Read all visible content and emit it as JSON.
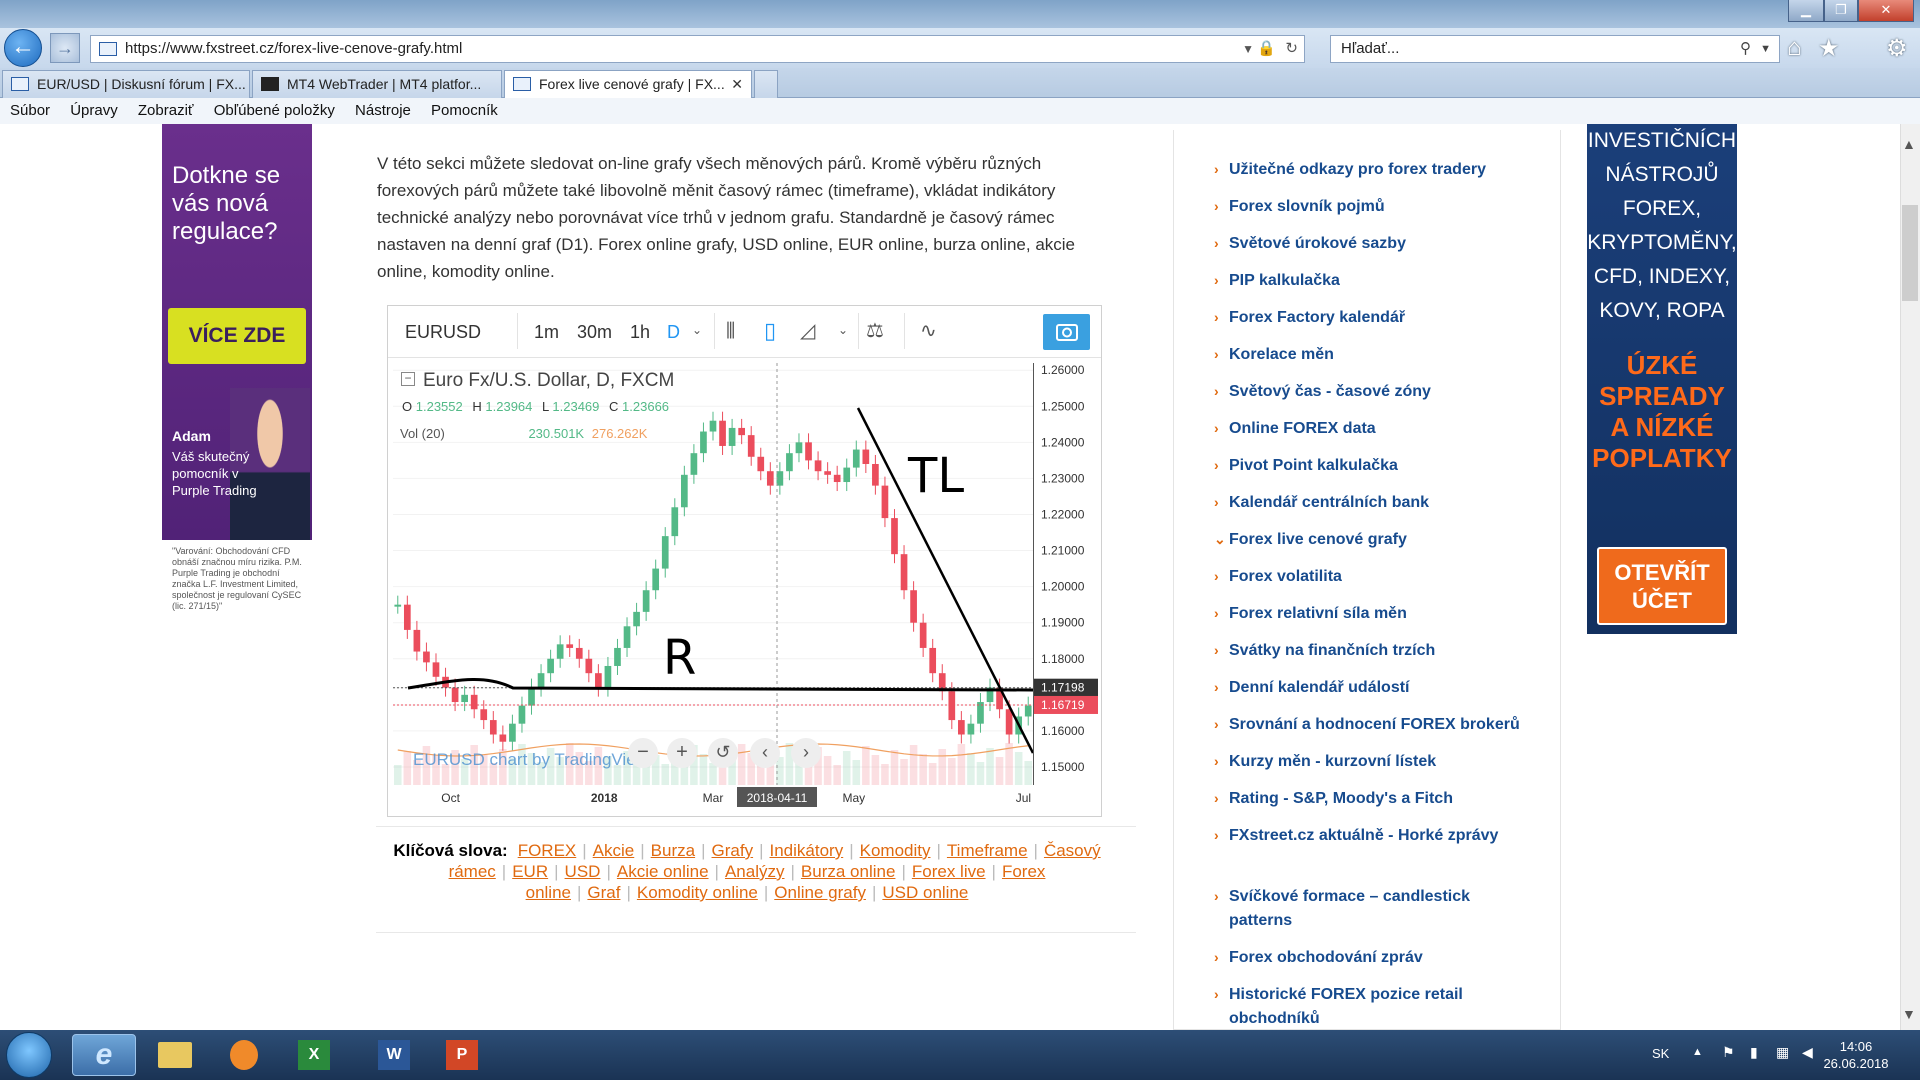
{
  "browser": {
    "url": "https://www.fxstreet.cz/forex-live-cenove-grafy.html",
    "search_placeholder": "Hľadať...",
    "tabs": [
      {
        "label": "EUR/USD | Diskusní fórum | FX..."
      },
      {
        "label": "MT4 WebTrader | MT4 platfor..."
      },
      {
        "label": "Forex live cenové grafy | FX..."
      }
    ],
    "menu": [
      "Súbor",
      "Úpravy",
      "Zobraziť",
      "Obľúbené položky",
      "Nástroje",
      "Pomocník"
    ]
  },
  "left_ad": {
    "headline": "Dotkne se vás nová regulace?",
    "cta": "VÍCE ZDE",
    "person_name": "Adam",
    "person_text": "Váš skutečný pomocník v Purple Trading",
    "warning": "\"Varování: Obchodování CFD obnáší značnou míru rizika. P.M. Purple Trading je obchodní značka L.F. Investment Limited, společnost je regulovaní CySEC (lic. 271/15)\""
  },
  "article": {
    "text": "V této sekci můžete sledovat on-line grafy všech měnových párů. Kromě výběru různých forexových párů můžete také libovolně měnit časový rámec (timeframe), vkládat indikátory technické analýzy nebo porovnávat více trhů v jednom grafu. Standardně je časový rámec nastaven na denní graf (D1). Forex online grafy, USD online, EUR online, burza online, akcie online, komodity online."
  },
  "chart_widget": {
    "symbol": "EURUSD",
    "timeframes": [
      "1m",
      "30m",
      "1h",
      "D"
    ],
    "title": "Euro Fx/U.S. Dollar, D, FXCM",
    "ohlc": {
      "o_label": "O",
      "o": "1.23552",
      "h_label": "H",
      "h": "1.23964",
      "l_label": "L",
      "l": "1.23469",
      "c_label": "C",
      "c": "1.23666"
    },
    "volume_label": "Vol (20)",
    "volume_values": [
      "230.501K",
      "276.262K"
    ],
    "watermark": "EURUSD chart by TradingView",
    "crosshair_date": "2018-04-11",
    "annotations": {
      "trendline": "TL",
      "resistance": "R"
    },
    "colors": {
      "up": "#53b987",
      "down": "#eb4d5c",
      "volume_ma": "#f0a060"
    }
  },
  "chart_data": {
    "type": "line",
    "title": "Euro Fx/U.S. Dollar, D, FXCM",
    "xlabel": "",
    "ylabel": "",
    "x_ticks": [
      "Oct",
      "2018",
      "Mar",
      "2018-04-11",
      "May",
      "Jul"
    ],
    "y_ticks": [
      "1.26000",
      "1.25000",
      "1.24000",
      "1.23000",
      "1.22000",
      "1.21000",
      "1.20000",
      "1.19000",
      "1.18000",
      "1.17198",
      "1.16719",
      "1.16000",
      "1.15000"
    ],
    "ylim": [
      1.145,
      1.262
    ],
    "price_labels": {
      "level": "1.17198",
      "last": "1.16719"
    },
    "series": [
      {
        "values": [
          1.195,
          1.188,
          1.182,
          1.179,
          1.175,
          1.172,
          1.168,
          1.17,
          1.166,
          1.163,
          1.159,
          1.157,
          1.162,
          1.167,
          1.172,
          1.176,
          1.18,
          1.184,
          1.183,
          1.18,
          1.176,
          1.172,
          1.178,
          1.183,
          1.189,
          1.193,
          1.199,
          1.205,
          1.214,
          1.222,
          1.231,
          1.237,
          1.243,
          1.246,
          1.239,
          1.244,
          1.242,
          1.236,
          1.232,
          1.228,
          1.232,
          1.237,
          1.24,
          1.235,
          1.232,
          1.231,
          1.229,
          1.233,
          1.238,
          1.234,
          1.228,
          1.219,
          1.209,
          1.199,
          1.19,
          1.183,
          1.176,
          1.171,
          1.163,
          1.159,
          1.162,
          1.168,
          1.172,
          1.166,
          1.159,
          1.164,
          1.167
        ]
      }
    ]
  },
  "keywords": {
    "label": "Klíčová slova:",
    "items": [
      "FOREX",
      "Akcie",
      "Burza",
      "Grafy",
      "Indikátory",
      "Komodity",
      "Timeframe",
      "Časový rámec",
      "EUR",
      "USD",
      "Akcie online",
      "Analýzy",
      "Burza online",
      "Forex live",
      "Forex online",
      "Graf",
      "Komodity online",
      "Online grafy",
      "USD online"
    ]
  },
  "sidebar_links": [
    "Užitečné odkazy pro forex tradery",
    "Forex slovník pojmů",
    "Světové úrokové sazby",
    "PIP kalkulačka",
    "Forex Factory kalendář",
    "Korelace měn",
    "Světový čas - časové zóny",
    "Online FOREX data",
    "Pivot Point kalkulačka",
    "Kalendář centrálních bank",
    "Forex live cenové grafy",
    "Forex volatilita",
    "Forex relativní síla měn",
    "Svátky na finančních trzích",
    "Denní kalendář událostí",
    "Srovnání a hodnocení FOREX brokerů",
    "Kurzy měn - kurzovní lístek",
    "Rating - S&P, Moody's a Fitch",
    "FXstreet.cz aktuálně - Horké zprávy",
    "Svíčkové formace – candlestick patterns",
    "Forex obchodování zpráv",
    "Historické FOREX pozice retail obchodníků"
  ],
  "right_ad": {
    "top": "INVESTIČNÍCH NÁSTROJŮ FOREX, KRYPTOMĚNY, CFD, INDEXY, KOVY, ROPA",
    "mid": "ÚZKÉ SPREADY A NÍZKÉ POPLATKY",
    "cta": "OTEVŘÍT ÚČET"
  },
  "taskbar": {
    "lang": "SK",
    "time": "14:06",
    "date": "26.06.2018"
  }
}
